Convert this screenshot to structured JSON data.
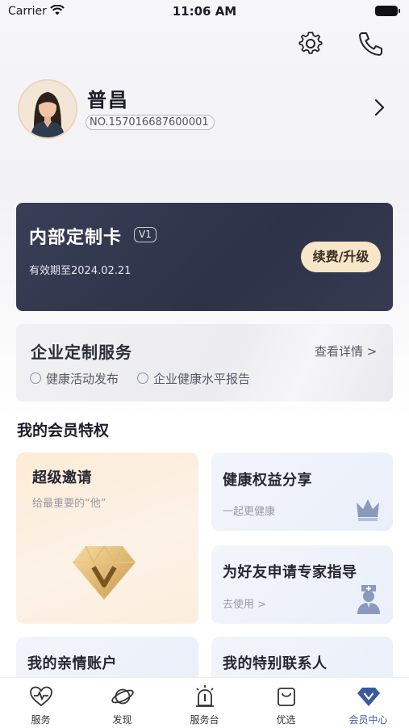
{
  "status_bar": {
    "carrier": "Carrier",
    "time": "11:06 AM"
  },
  "profile": {
    "name": "普昌",
    "member_no": "NO.157016687600001"
  },
  "member_card": {
    "title": "内部定制卡",
    "level": "V1",
    "valid_until": "有效期至2024.02.21",
    "action_label": "续费/升级"
  },
  "enterprise": {
    "title": "企业定制服务",
    "more_label": "查看详情 >",
    "items": [
      "健康活动发布",
      "企业健康水平报告"
    ]
  },
  "privileges": {
    "section_title": "我的会员特权",
    "tiles": [
      {
        "title": "超级邀请",
        "subtitle": "给最重要的“他”"
      },
      {
        "title": "健康权益分享",
        "subtitle": "一起更健康"
      },
      {
        "title": "为好友申请专家指导",
        "subtitle": "去使用 >"
      },
      {
        "title": "我的亲情账户"
      },
      {
        "title": "我的特别联系人"
      }
    ]
  },
  "bottom_nav": [
    {
      "label": "服务",
      "icon": "heart-pulse-icon"
    },
    {
      "label": "发现",
      "icon": "planet-icon"
    },
    {
      "label": "服务台",
      "icon": "alarm-light-icon"
    },
    {
      "label": "优选",
      "icon": "shopping-bag-icon"
    },
    {
      "label": "会员中心",
      "icon": "diamond-icon",
      "active": true
    }
  ],
  "colors": {
    "accent": "#3d5a9e",
    "card_dark": "#32364d",
    "gold": "#f8e6c8"
  }
}
